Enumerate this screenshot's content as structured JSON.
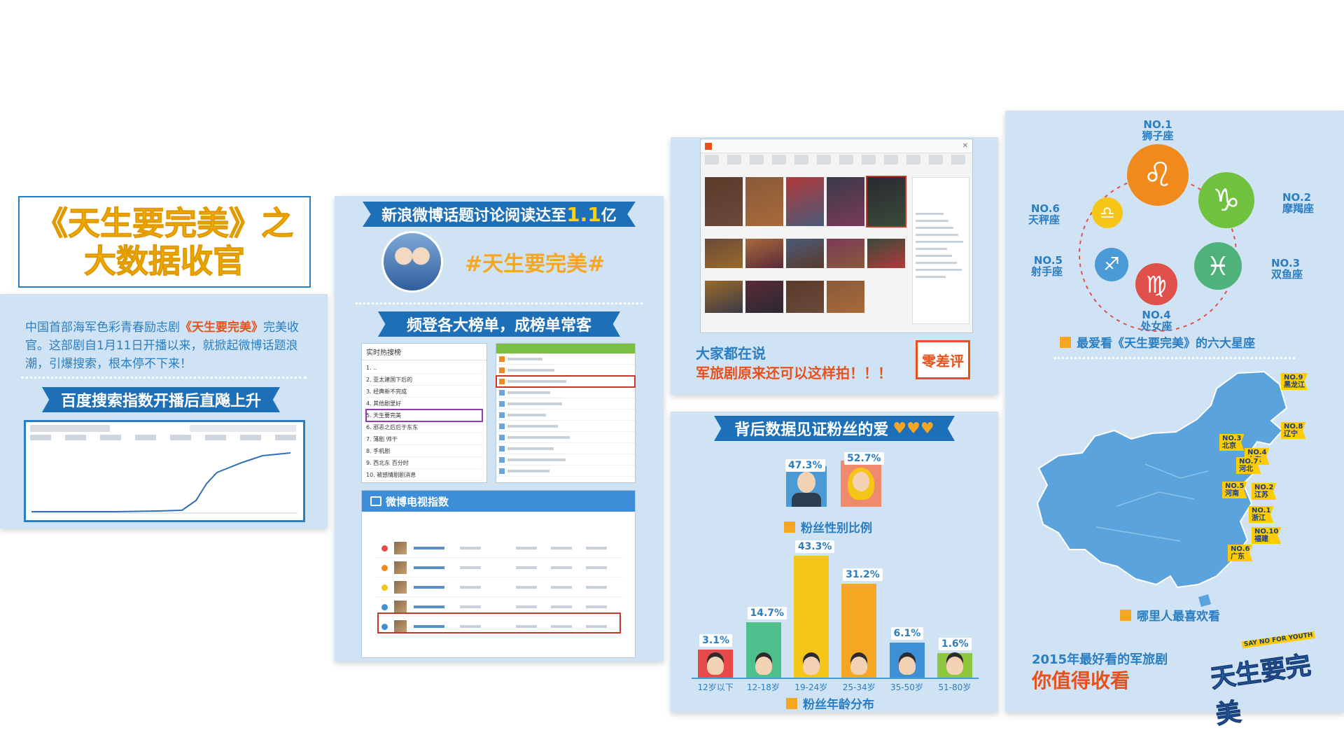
{
  "panel1": {
    "title_line1": "《天生要完美》之",
    "title_line2": "大数据收官",
    "intro_before": "中国首部海军色彩青春励志剧",
    "intro_highlight": "《天生要完美》",
    "intro_after": "完美收官。这部剧自1月11日开播以来，就掀起微博话题浪潮，引爆搜索，根本停不下来！",
    "ribbon": "百度搜索指数开播后直飚上升"
  },
  "panel2": {
    "ribbon1_before": "新浪微博话题讨论阅读达至",
    "ribbon1_highlight": "1.1",
    "ribbon1_after": "亿",
    "hashtag": "#天生要完美#",
    "ribbon2": "频登各大榜单，成榜单常客",
    "ranking_title": "实时热搜榜",
    "ranking_items": [
      "1. ..",
      "2. 亚太建国下后的",
      "3. 经典新不完成",
      "4. 其他剧里好",
      "5. 天生要完美",
      "6. 邪恶之后后于东东",
      "7. 薄剧 帅干",
      "8. 手机剧",
      "9. 西北东 百分时",
      "10. 被感情剧剧消息"
    ],
    "tv_index_label": "微博电视指数"
  },
  "panel3": {
    "caption_line1": "大家都在说",
    "caption_line2": "军旅剧原来还可以这样拍！！！",
    "stamp": "零差评"
  },
  "panel4": {
    "ribbon": "背后数据见证粉丝的爱",
    "gender_male": "47.3%",
    "gender_female": "52.7%",
    "gender_caption": "粉丝性别比例",
    "age_caption": "粉丝年龄分布"
  },
  "panel5": {
    "zodiac_caption": "最爱看《天生要完美》的六大星座",
    "zodiacs": [
      {
        "rank": "NO.1",
        "name": "狮子座",
        "glyph": "♌",
        "color": "#f08a1c"
      },
      {
        "rank": "NO.2",
        "name": "摩羯座",
        "glyph": "♑",
        "color": "#6fc13e"
      },
      {
        "rank": "NO.3",
        "name": "双鱼座",
        "glyph": "♓",
        "color": "#4fb27b"
      },
      {
        "rank": "NO.4",
        "name": "处女座",
        "glyph": "♍",
        "color": "#e0514c"
      },
      {
        "rank": "NO.5",
        "name": "射手座",
        "glyph": "♐",
        "color": "#4a9ad6"
      },
      {
        "rank": "NO.6",
        "name": "天秤座",
        "glyph": "♎",
        "color": "#f5c518"
      }
    ],
    "map_caption": "哪里人最喜欢看",
    "regions": [
      {
        "rank": "NO.9",
        "name": "黑龙江"
      },
      {
        "rank": "NO.8",
        "name": "辽宁"
      },
      {
        "rank": "NO.3",
        "name": "北京"
      },
      {
        "rank": "NO.4",
        "name": "山东"
      },
      {
        "rank": "NO.7",
        "name": "河北"
      },
      {
        "rank": "NO.5",
        "name": "河南"
      },
      {
        "rank": "NO.2",
        "name": "江苏"
      },
      {
        "rank": "NO.1",
        "name": "浙江"
      },
      {
        "rank": "NO.10",
        "name": "福建"
      },
      {
        "rank": "NO.6",
        "name": "广东"
      }
    ],
    "footer_line1": "2015年最好看的军旅剧",
    "footer_line2": "你值得收看",
    "logo_small": "SAY NO FOR YOUTH",
    "logo_big": "天生要完美"
  },
  "chart_data": {
    "type": "bar",
    "title": "",
    "xlabel": "粉丝年龄分布",
    "ylabel": "",
    "categories": [
      "12岁以下",
      "12-18岁",
      "19-24岁",
      "25-34岁",
      "35-50岁",
      "51-80岁"
    ],
    "values": [
      3.1,
      14.7,
      43.3,
      31.2,
      6.1,
      1.6
    ],
    "value_labels": [
      "3.1%",
      "14.7%",
      "43.3%",
      "31.2%",
      "6.1%",
      "1.6%"
    ],
    "colors": [
      "#e84a4a",
      "#4fc08d",
      "#f5c518",
      "#f5a623",
      "#3d8fd6",
      "#8dc63f"
    ],
    "ylim": [
      0,
      45
    ]
  }
}
